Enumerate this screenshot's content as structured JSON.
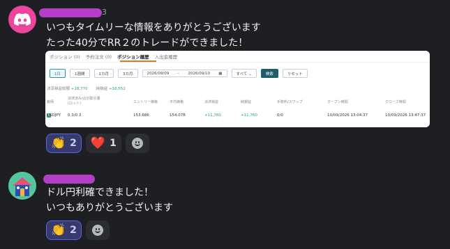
{
  "messages": [
    {
      "timestamp_partial": "3",
      "lines": [
        "いつもタイムリーな情報をありがとうございます",
        "たった40分でRR２のトレードができました！"
      ],
      "reactions": [
        {
          "emoji": "👏",
          "emoji_name": "clap-icon",
          "count": "2",
          "mine": true
        },
        {
          "emoji": "❤️",
          "emoji_name": "heart-icon",
          "count": "1",
          "mine": false
        }
      ]
    },
    {
      "lines": [
        "ドル円利確できました！",
        "いつもありがとうございます"
      ],
      "reactions": [
        {
          "emoji": "👏",
          "emoji_name": "clap-icon",
          "count": "2",
          "mine": true
        }
      ]
    }
  ],
  "trade_screenshot": {
    "tabs": [
      "ポジション (0)",
      "予約注文 (0)",
      "ポジション履歴",
      "入出金履歴"
    ],
    "active_tab": "ポジション履歴",
    "periods": [
      "1日",
      "1週間",
      "1カ月",
      "3カ月"
    ],
    "date_from": "2026/09/09",
    "date_sep": "–",
    "date_to": "2026/09/10",
    "filter_select": "すべて ⌄",
    "search_button": "検索",
    "reset_button": "リセット",
    "settled_label": "決済損益総額",
    "settled_value": "+18,770",
    "net_label": "純損益",
    "net_value": "+18,552",
    "columns": [
      "銘柄",
      "決済済み/合計取引量\n(ロット)",
      "エントリー価格",
      "平均価格",
      "決済損益",
      "純損益",
      "手数料/スワップ",
      "オープン時間",
      "クローズ時間"
    ],
    "row": {
      "symbol": "USDJPY",
      "lots": "0.3/0.3",
      "entry": "153.686",
      "avg": "154.078",
      "pnl": "+11,760",
      "net": "+11,760",
      "fee": "0/0",
      "open": "10/09/2026 13:04:37",
      "close": "10/09/2026 13:47:37"
    }
  },
  "colors": {
    "background": "#1e1f22",
    "redaction": "#b43ec8",
    "discord_blurple": "#5865f2"
  }
}
